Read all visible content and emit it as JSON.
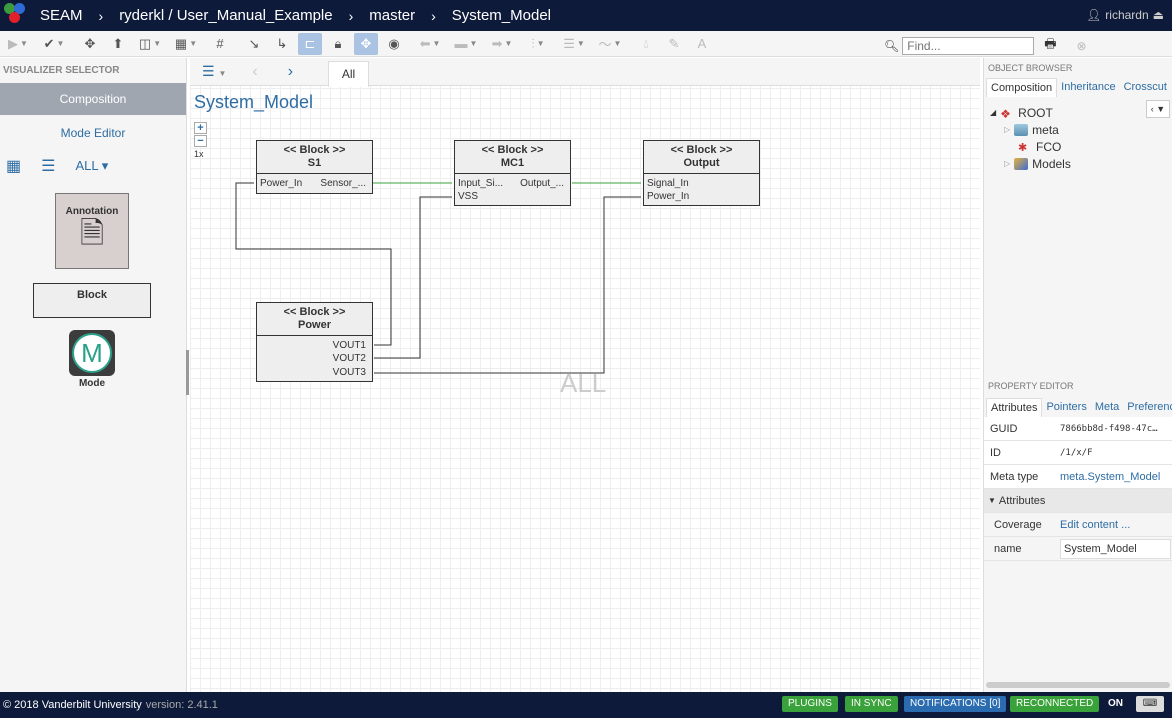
{
  "header": {
    "app_name": "SEAM",
    "breadcrumbs": [
      "ryderkl / User_Manual_Example",
      "master",
      "System_Model"
    ],
    "user": "richardn"
  },
  "toolbar": {
    "search_placeholder": "Find..."
  },
  "visualizer": {
    "title": "VISUALIZER SELECTOR",
    "items": [
      {
        "label": "Composition"
      },
      {
        "label": "Mode Editor"
      }
    ],
    "filter_label": "ALL"
  },
  "palette": {
    "items": [
      {
        "label": "Annotation"
      },
      {
        "label": "Block"
      },
      {
        "label": "Mode",
        "glyph": "M"
      }
    ]
  },
  "canvas": {
    "tab_label": "All",
    "model_title": "System_Model",
    "zoom_label": "1x",
    "watermark": "ALL",
    "blocks": [
      {
        "stereotype": "<< Block >>",
        "name": "S1",
        "ports": [
          "Power_In",
          "Sensor_..."
        ]
      },
      {
        "stereotype": "<< Block >>",
        "name": "MC1",
        "ports": [
          "Input_Si...",
          "Output_...",
          "VSS"
        ]
      },
      {
        "stereotype": "<< Block >>",
        "name": "Output",
        "ports": [
          "Signal_In",
          "Power_In"
        ]
      },
      {
        "stereotype": "<< Block >>",
        "name": "Power",
        "ports": [
          "VOUT1",
          "VOUT2",
          "VOUT3"
        ]
      }
    ]
  },
  "object_browser": {
    "title": "OBJECT BROWSER",
    "tabs": [
      "Composition",
      "Inheritance",
      "Crosscut"
    ],
    "tree": [
      {
        "label": "ROOT"
      },
      {
        "label": "meta"
      },
      {
        "label": "FCO"
      },
      {
        "label": "Models"
      }
    ]
  },
  "property_editor": {
    "title": "PROPERTY EDITOR",
    "tabs": [
      "Attributes",
      "Pointers",
      "Meta",
      "Preferences"
    ],
    "guid_label": "GUID",
    "guid_value": "7866bb8d-f498-47c…",
    "id_label": "ID",
    "id_value": "/1/x/F",
    "metatype_label": "Meta type",
    "metatype_value": "meta.System_Model",
    "section_label": "Attributes",
    "coverage_label": "Coverage",
    "coverage_value": "Edit content ...",
    "name_label": "name",
    "name_value": "System_Model"
  },
  "footer": {
    "copyright": "© 2018 Vanderbilt University",
    "version": "version: 2.41.1",
    "badges": [
      "PLUGINS",
      "IN SYNC",
      "NOTIFICATIONS [0]",
      "RECONNECTED",
      "ON"
    ],
    "colors": {
      "green": "#3aa23a",
      "blue": "#2b6cb0"
    }
  }
}
